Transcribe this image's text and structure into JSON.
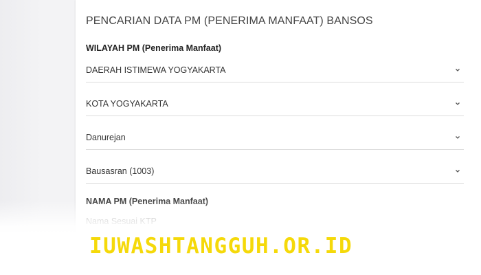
{
  "header": {
    "title": "PENCARIAN DATA PM (PENERIMA MANFAAT) BANSOS"
  },
  "wilayah": {
    "label": "WILAYAH PM (Penerima Manfaat)",
    "province": {
      "selected": "DAERAH ISTIMEWA YOGYAKARTA",
      "icon": "chevron-down-icon"
    },
    "city": {
      "selected": "KOTA YOGYAKARTA",
      "icon": "chevron-down-icon"
    },
    "district": {
      "selected": "Danurejan",
      "icon": "chevron-down-icon"
    },
    "village": {
      "selected": "Bausasran (1003)",
      "icon": "chevron-down-icon"
    }
  },
  "nama": {
    "label": "NAMA PM (Penerima Manfaat)",
    "input": {
      "value": "",
      "placeholder": "Nama Sesuai KTP"
    }
  },
  "watermark": {
    "text": "IUWASHTANGGUH.OR.ID",
    "color": "#f5d90a"
  },
  "colors": {
    "card": "#ffffff",
    "background": "#f3f3f5",
    "divider": "#dcdcdc"
  }
}
